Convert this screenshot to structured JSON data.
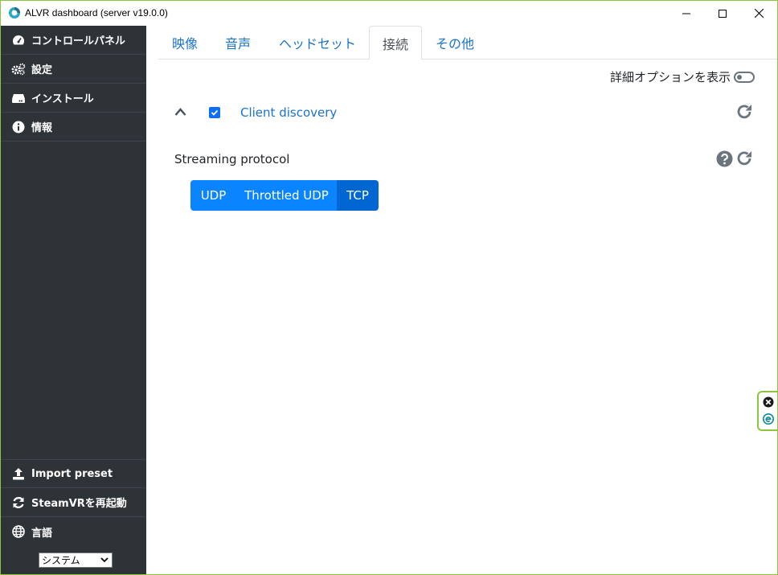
{
  "window": {
    "title": "ALVR dashboard (server v19.0.0)"
  },
  "sidebar": {
    "items": [
      {
        "label": "コントロールパネル",
        "icon": "dashboard-icon"
      },
      {
        "label": "設定",
        "icon": "cogs-icon"
      },
      {
        "label": "インストール",
        "icon": "hdd-icon"
      },
      {
        "label": "情報",
        "icon": "info-icon"
      }
    ],
    "bottom_items": [
      {
        "label": "Import preset",
        "icon": "upload-icon"
      },
      {
        "label": "SteamVRを再起動",
        "icon": "sync-icon"
      },
      {
        "label": "言語",
        "icon": "globe-icon"
      }
    ],
    "language_select": {
      "value": "システム"
    }
  },
  "tabs": [
    {
      "label": "映像",
      "active": false
    },
    {
      "label": "音声",
      "active": false
    },
    {
      "label": "ヘッドセット",
      "active": false
    },
    {
      "label": "接続",
      "active": true
    },
    {
      "label": "その他",
      "active": false
    }
  ],
  "content": {
    "advanced_toggle_label": "詳細オプションを表示",
    "client_discovery": {
      "label": "Client discovery",
      "checked": true
    },
    "streaming_protocol": {
      "label": "Streaming protocol",
      "options": [
        "UDP",
        "Throttled UDP",
        "TCP"
      ],
      "selected": "TCP"
    }
  },
  "colors": {
    "sidebar_bg": "#2e3338",
    "accent": "#0b85ff",
    "accent_active": "#0066d1",
    "link": "#1a73c9",
    "window_border": "#8cc63f"
  }
}
